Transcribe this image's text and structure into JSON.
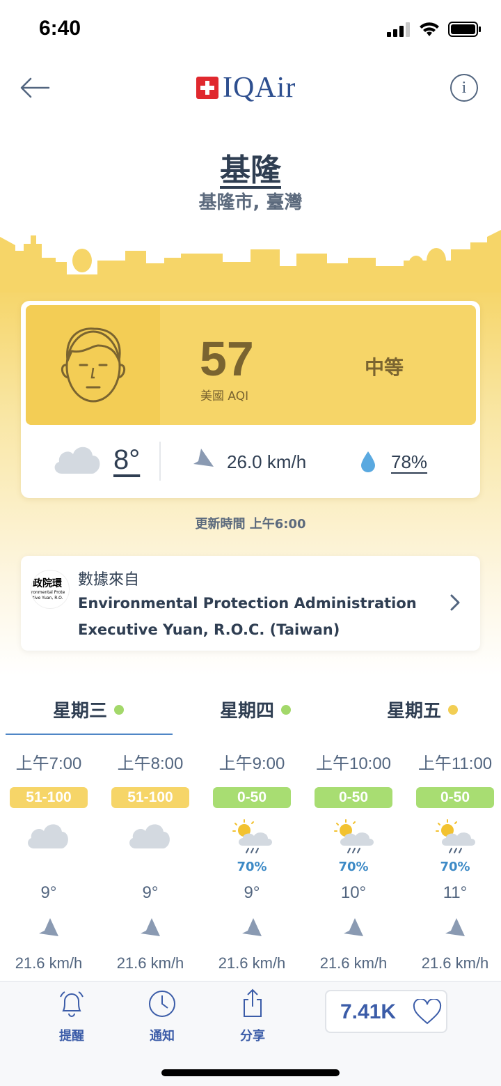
{
  "status_bar": {
    "time": "6:40"
  },
  "brand": {
    "name": "IQAir"
  },
  "location": {
    "city": "基隆",
    "region": "基隆市, 臺灣"
  },
  "aqi": {
    "value": "57",
    "label": "美國 AQI",
    "status": "中等"
  },
  "weather": {
    "temperature": "8°",
    "wind": "26.0 km/h",
    "humidity": "78%"
  },
  "updated": "更新時間 上午6:00",
  "source": {
    "label": "數據來自",
    "name_line1": "Environmental Protection Administration",
    "name_line2": "Executive Yuan, R.O.C. (Taiwan)",
    "logo_text": "政院環",
    "logo_sub1": "ronmental Prote",
    "logo_sub2": "tive Yuan, R.O."
  },
  "days": [
    {
      "label": "星期三",
      "dot_color": "#a3d86a"
    },
    {
      "label": "星期四",
      "dot_color": "#a3d86a"
    },
    {
      "label": "星期五",
      "dot_color": "#f2ce54"
    }
  ],
  "hourly": [
    {
      "time": "上午7:00",
      "aqi": "51-100",
      "aqi_color": "#f6d568",
      "icon": "cloud-icon",
      "rain": "",
      "temp": "9°",
      "wind": "21.6 km/h"
    },
    {
      "time": "上午8:00",
      "aqi": "51-100",
      "aqi_color": "#f6d568",
      "icon": "cloud-icon",
      "rain": "",
      "temp": "9°",
      "wind": "21.6 km/h"
    },
    {
      "time": "上午9:00",
      "aqi": "0-50",
      "aqi_color": "#a8dd72",
      "icon": "sun-rain-icon",
      "rain": "70%",
      "temp": "9°",
      "wind": "21.6 km/h"
    },
    {
      "time": "上午10:00",
      "aqi": "0-50",
      "aqi_color": "#a8dd72",
      "icon": "sun-rain-icon",
      "rain": "70%",
      "temp": "10°",
      "wind": "21.6 km/h"
    },
    {
      "time": "上午11:00",
      "aqi": "0-50",
      "aqi_color": "#a8dd72",
      "icon": "sun-rain-icon",
      "rain": "70%",
      "temp": "11°",
      "wind": "21.6 km/h"
    }
  ],
  "bottom_bar": {
    "alerts": "提醒",
    "notifications": "通知",
    "share": "分享",
    "likes": "7.41K"
  }
}
